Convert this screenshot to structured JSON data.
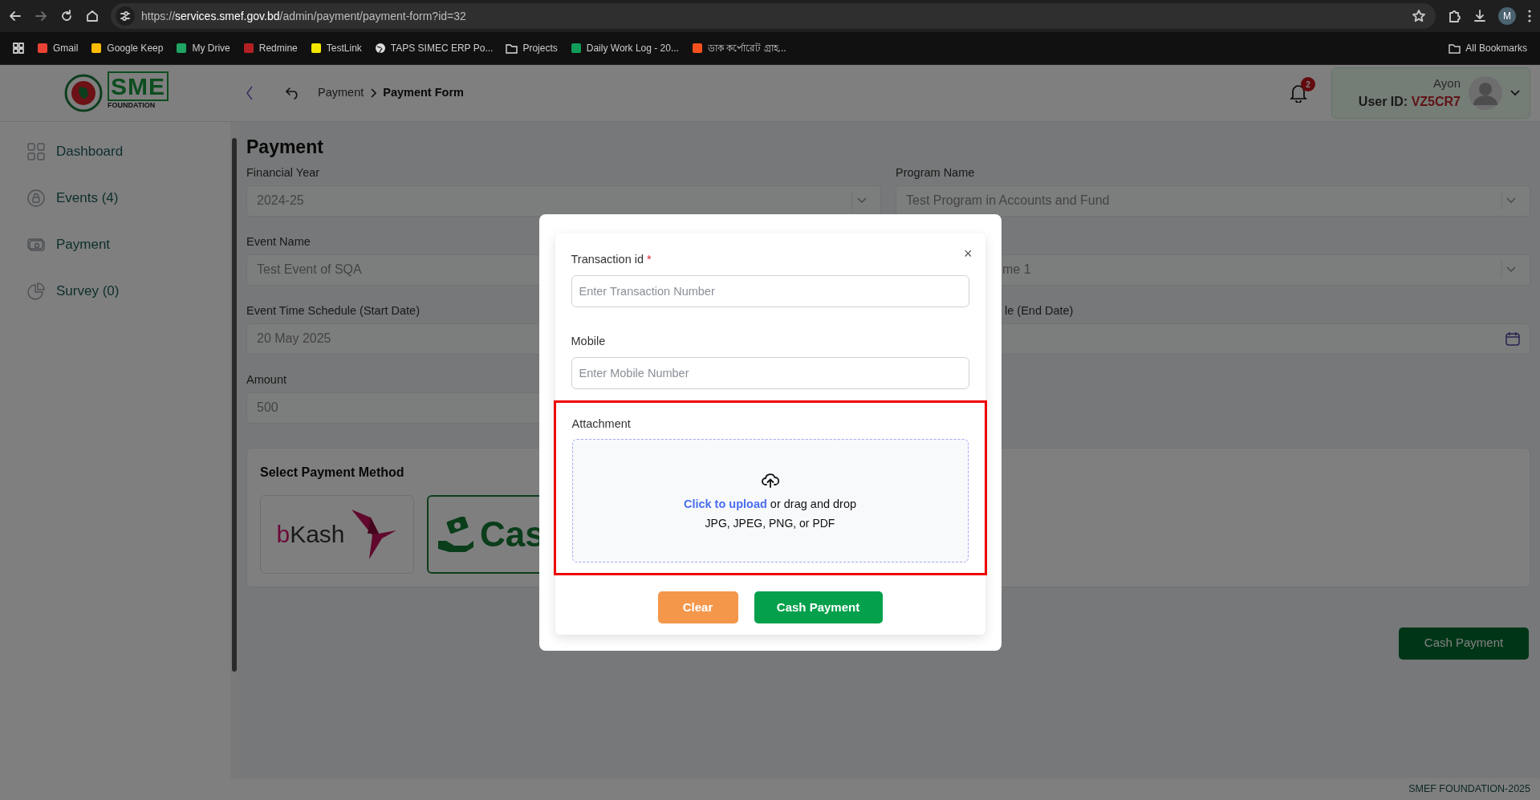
{
  "browser": {
    "url": {
      "scheme": "https://",
      "host": "services.smef.gov.bd",
      "path": "/admin/payment/payment-form?id=32"
    },
    "profile_initial": "M",
    "bookmarks": [
      {
        "label": "Gmail",
        "kind": "site",
        "color": "#ea4335"
      },
      {
        "label": "Google Keep",
        "kind": "site",
        "color": "#fbbc04"
      },
      {
        "label": "My Drive",
        "kind": "site",
        "color": "#1fa463"
      },
      {
        "label": "Redmine",
        "kind": "site",
        "color": "#b32024"
      },
      {
        "label": "TestLink",
        "kind": "site",
        "color": "#f2e600"
      },
      {
        "label": "TAPS SIMEC ERP Po...",
        "kind": "globe"
      },
      {
        "label": "Projects",
        "kind": "folder"
      },
      {
        "label": "Daily Work Log - 20...",
        "kind": "site",
        "color": "#0f9d58"
      },
      {
        "label": "ডাক কর্পোরেট গ্রাহ...",
        "kind": "site",
        "color": "#f4511e"
      }
    ],
    "all_bookmarks": "All Bookmarks"
  },
  "header": {
    "logo_letters": "SME",
    "logo_caption": "FOUNDATION",
    "breadcrumb": [
      {
        "label": "Payment",
        "current": false
      },
      {
        "label": "Payment Form",
        "current": true
      }
    ],
    "notification_count": "2",
    "user": {
      "name": "Ayon",
      "id_label": "User ID:",
      "id": "VZ5CR7"
    }
  },
  "sidebar": {
    "items": [
      {
        "label": "Dashboard",
        "kind": "grid"
      },
      {
        "label": "Events (4)",
        "kind": "lock"
      },
      {
        "label": "Payment",
        "kind": "money"
      },
      {
        "label": "Survey (0)",
        "kind": "pie"
      }
    ]
  },
  "page": {
    "title": "Payment",
    "fields": [
      {
        "label": "Financial Year",
        "value": "2024-25",
        "kind": "select",
        "obscured": false
      },
      {
        "label": "Program Name",
        "value": "Test Program in Accounts and Fund",
        "kind": "select",
        "obscured": false
      },
      {
        "label": "Event Name",
        "value": "Test Event of SQA",
        "kind": "text",
        "obscured": false
      },
      {
        "value": "me 1",
        "kind": "select",
        "obscured": true
      },
      {
        "label": "Event Time Schedule (Start Date)",
        "value": "20 May 2025",
        "kind": "text",
        "obscured": false
      },
      {
        "label": "le (End Date)",
        "kind": "date",
        "obscured": true
      },
      {
        "label": "Amount",
        "value": "500",
        "kind": "text",
        "obscured": false
      }
    ],
    "payment_methods": {
      "title": "Select Payment Method",
      "options": [
        {
          "label": "bKash",
          "kind": "bkash",
          "selected": false
        },
        {
          "label": "Cas",
          "kind": "cash",
          "selected": true
        }
      ]
    },
    "submit_button": "Cash Payment"
  },
  "footer": "SMEF FOUNDATION-2025",
  "modal": {
    "close": "×",
    "fields": [
      {
        "label": "Transaction id",
        "required_mark": "*",
        "placeholder": "Enter Transaction Number"
      },
      {
        "label": "Mobile",
        "placeholder": "Enter Mobile Number"
      }
    ],
    "attachment": {
      "label": "Attachment",
      "highlighted": true,
      "link": "Click to upload",
      "text": " or drag and drop",
      "formats": "JPG, JPEG, PNG, or PDF"
    },
    "buttons": [
      {
        "label": "Clear",
        "kind": "secondary"
      },
      {
        "label": "Cash Payment",
        "kind": "primary"
      }
    ]
  }
}
